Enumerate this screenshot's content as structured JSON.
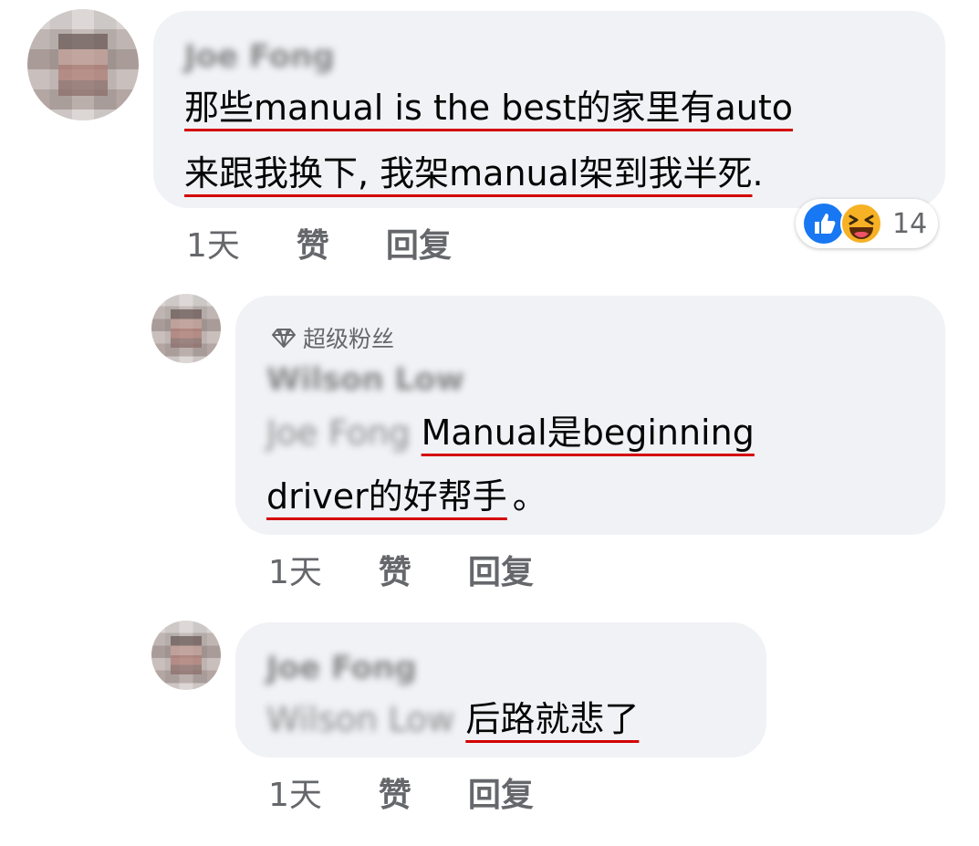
{
  "comments": [
    {
      "author": "Joe Fong",
      "line1": "那些manual is the best的家里有auto",
      "line2": "来跟我换下, 我架manual架到我半死",
      "line2_end": ".",
      "time": "1天",
      "like": "赞",
      "reply": "回复",
      "reaction_count": "14"
    },
    {
      "badge": "超级粉丝",
      "author": "Wilson Low",
      "mention": "Joe Fong",
      "line1": "Manual是beginning",
      "line2": "driver的好帮手",
      "line2_end": "。",
      "time": "1天",
      "like": "赞",
      "reply": "回复"
    },
    {
      "author": "Joe Fong",
      "mention": "Wilson Low",
      "line1": "后路就悲了",
      "time": "1天",
      "like": "赞",
      "reply": "回复"
    }
  ],
  "colors": {
    "bubble": "#f0f2f5",
    "underline": "#d40000",
    "meta": "#65676b",
    "like_blue": "#1877f2",
    "haha_yellow": "#f7b125"
  }
}
